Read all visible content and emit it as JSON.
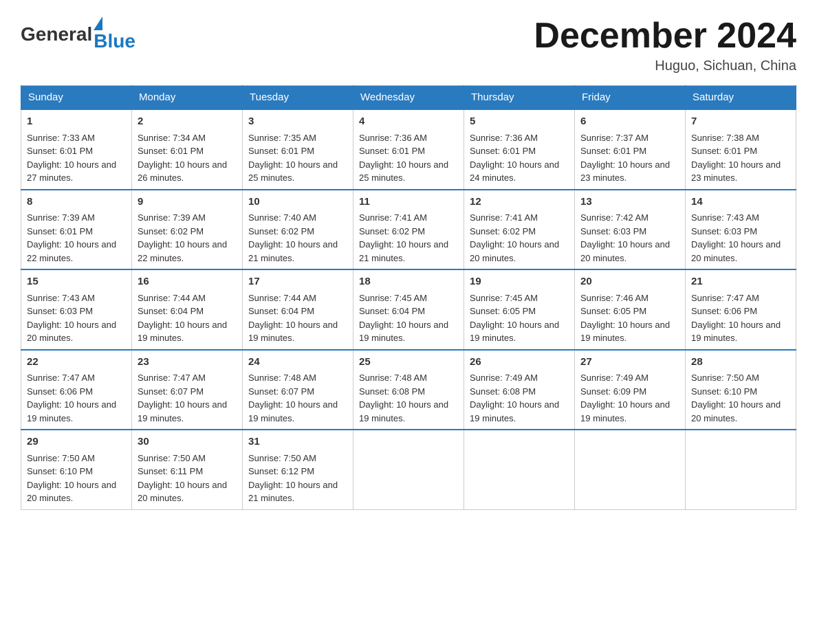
{
  "header": {
    "logo_general": "General",
    "logo_blue": "Blue",
    "month_title": "December 2024",
    "location": "Huguo, Sichuan, China"
  },
  "days_of_week": [
    "Sunday",
    "Monday",
    "Tuesday",
    "Wednesday",
    "Thursday",
    "Friday",
    "Saturday"
  ],
  "weeks": [
    [
      {
        "day": "1",
        "sunrise": "7:33 AM",
        "sunset": "6:01 PM",
        "daylight": "10 hours and 27 minutes."
      },
      {
        "day": "2",
        "sunrise": "7:34 AM",
        "sunset": "6:01 PM",
        "daylight": "10 hours and 26 minutes."
      },
      {
        "day": "3",
        "sunrise": "7:35 AM",
        "sunset": "6:01 PM",
        "daylight": "10 hours and 25 minutes."
      },
      {
        "day": "4",
        "sunrise": "7:36 AM",
        "sunset": "6:01 PM",
        "daylight": "10 hours and 25 minutes."
      },
      {
        "day": "5",
        "sunrise": "7:36 AM",
        "sunset": "6:01 PM",
        "daylight": "10 hours and 24 minutes."
      },
      {
        "day": "6",
        "sunrise": "7:37 AM",
        "sunset": "6:01 PM",
        "daylight": "10 hours and 23 minutes."
      },
      {
        "day": "7",
        "sunrise": "7:38 AM",
        "sunset": "6:01 PM",
        "daylight": "10 hours and 23 minutes."
      }
    ],
    [
      {
        "day": "8",
        "sunrise": "7:39 AM",
        "sunset": "6:01 PM",
        "daylight": "10 hours and 22 minutes."
      },
      {
        "day": "9",
        "sunrise": "7:39 AM",
        "sunset": "6:02 PM",
        "daylight": "10 hours and 22 minutes."
      },
      {
        "day": "10",
        "sunrise": "7:40 AM",
        "sunset": "6:02 PM",
        "daylight": "10 hours and 21 minutes."
      },
      {
        "day": "11",
        "sunrise": "7:41 AM",
        "sunset": "6:02 PM",
        "daylight": "10 hours and 21 minutes."
      },
      {
        "day": "12",
        "sunrise": "7:41 AM",
        "sunset": "6:02 PM",
        "daylight": "10 hours and 20 minutes."
      },
      {
        "day": "13",
        "sunrise": "7:42 AM",
        "sunset": "6:03 PM",
        "daylight": "10 hours and 20 minutes."
      },
      {
        "day": "14",
        "sunrise": "7:43 AM",
        "sunset": "6:03 PM",
        "daylight": "10 hours and 20 minutes."
      }
    ],
    [
      {
        "day": "15",
        "sunrise": "7:43 AM",
        "sunset": "6:03 PM",
        "daylight": "10 hours and 20 minutes."
      },
      {
        "day": "16",
        "sunrise": "7:44 AM",
        "sunset": "6:04 PM",
        "daylight": "10 hours and 19 minutes."
      },
      {
        "day": "17",
        "sunrise": "7:44 AM",
        "sunset": "6:04 PM",
        "daylight": "10 hours and 19 minutes."
      },
      {
        "day": "18",
        "sunrise": "7:45 AM",
        "sunset": "6:04 PM",
        "daylight": "10 hours and 19 minutes."
      },
      {
        "day": "19",
        "sunrise": "7:45 AM",
        "sunset": "6:05 PM",
        "daylight": "10 hours and 19 minutes."
      },
      {
        "day": "20",
        "sunrise": "7:46 AM",
        "sunset": "6:05 PM",
        "daylight": "10 hours and 19 minutes."
      },
      {
        "day": "21",
        "sunrise": "7:47 AM",
        "sunset": "6:06 PM",
        "daylight": "10 hours and 19 minutes."
      }
    ],
    [
      {
        "day": "22",
        "sunrise": "7:47 AM",
        "sunset": "6:06 PM",
        "daylight": "10 hours and 19 minutes."
      },
      {
        "day": "23",
        "sunrise": "7:47 AM",
        "sunset": "6:07 PM",
        "daylight": "10 hours and 19 minutes."
      },
      {
        "day": "24",
        "sunrise": "7:48 AM",
        "sunset": "6:07 PM",
        "daylight": "10 hours and 19 minutes."
      },
      {
        "day": "25",
        "sunrise": "7:48 AM",
        "sunset": "6:08 PM",
        "daylight": "10 hours and 19 minutes."
      },
      {
        "day": "26",
        "sunrise": "7:49 AM",
        "sunset": "6:08 PM",
        "daylight": "10 hours and 19 minutes."
      },
      {
        "day": "27",
        "sunrise": "7:49 AM",
        "sunset": "6:09 PM",
        "daylight": "10 hours and 19 minutes."
      },
      {
        "day": "28",
        "sunrise": "7:50 AM",
        "sunset": "6:10 PM",
        "daylight": "10 hours and 20 minutes."
      }
    ],
    [
      {
        "day": "29",
        "sunrise": "7:50 AM",
        "sunset": "6:10 PM",
        "daylight": "10 hours and 20 minutes."
      },
      {
        "day": "30",
        "sunrise": "7:50 AM",
        "sunset": "6:11 PM",
        "daylight": "10 hours and 20 minutes."
      },
      {
        "day": "31",
        "sunrise": "7:50 AM",
        "sunset": "6:12 PM",
        "daylight": "10 hours and 21 minutes."
      },
      null,
      null,
      null,
      null
    ]
  ],
  "labels": {
    "sunrise": "Sunrise:",
    "sunset": "Sunset:",
    "daylight": "Daylight:"
  }
}
